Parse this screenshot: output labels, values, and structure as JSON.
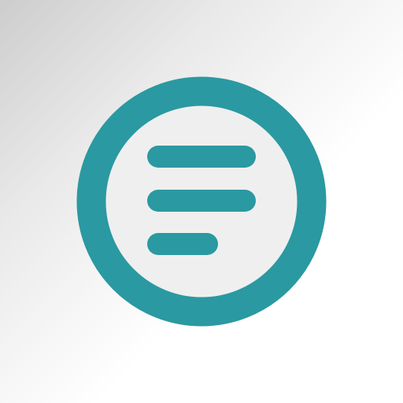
{
  "icon": {
    "name": "menu-lines-icon",
    "accent_color": "#2a99a1",
    "inner_fill_color": "#efefef"
  }
}
